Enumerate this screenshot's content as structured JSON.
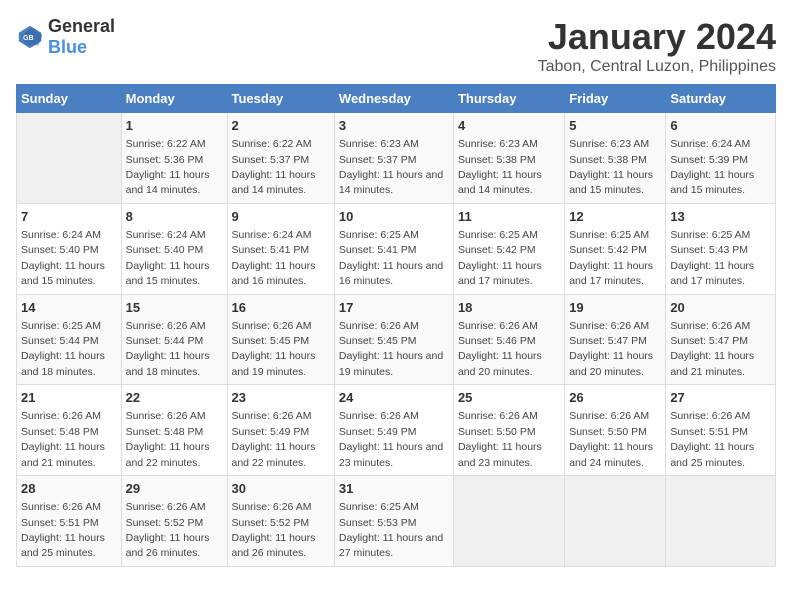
{
  "logo": {
    "text_general": "General",
    "text_blue": "Blue"
  },
  "title": "January 2024",
  "subtitle": "Tabon, Central Luzon, Philippines",
  "days_of_week": [
    "Sunday",
    "Monday",
    "Tuesday",
    "Wednesday",
    "Thursday",
    "Friday",
    "Saturday"
  ],
  "weeks": [
    [
      {
        "day": "",
        "sunrise": "",
        "sunset": "",
        "daylight": ""
      },
      {
        "day": "1",
        "sunrise": "Sunrise: 6:22 AM",
        "sunset": "Sunset: 5:36 PM",
        "daylight": "Daylight: 11 hours and 14 minutes."
      },
      {
        "day": "2",
        "sunrise": "Sunrise: 6:22 AM",
        "sunset": "Sunset: 5:37 PM",
        "daylight": "Daylight: 11 hours and 14 minutes."
      },
      {
        "day": "3",
        "sunrise": "Sunrise: 6:23 AM",
        "sunset": "Sunset: 5:37 PM",
        "daylight": "Daylight: 11 hours and 14 minutes."
      },
      {
        "day": "4",
        "sunrise": "Sunrise: 6:23 AM",
        "sunset": "Sunset: 5:38 PM",
        "daylight": "Daylight: 11 hours and 14 minutes."
      },
      {
        "day": "5",
        "sunrise": "Sunrise: 6:23 AM",
        "sunset": "Sunset: 5:38 PM",
        "daylight": "Daylight: 11 hours and 15 minutes."
      },
      {
        "day": "6",
        "sunrise": "Sunrise: 6:24 AM",
        "sunset": "Sunset: 5:39 PM",
        "daylight": "Daylight: 11 hours and 15 minutes."
      }
    ],
    [
      {
        "day": "7",
        "sunrise": "Sunrise: 6:24 AM",
        "sunset": "Sunset: 5:40 PM",
        "daylight": "Daylight: 11 hours and 15 minutes."
      },
      {
        "day": "8",
        "sunrise": "Sunrise: 6:24 AM",
        "sunset": "Sunset: 5:40 PM",
        "daylight": "Daylight: 11 hours and 15 minutes."
      },
      {
        "day": "9",
        "sunrise": "Sunrise: 6:24 AM",
        "sunset": "Sunset: 5:41 PM",
        "daylight": "Daylight: 11 hours and 16 minutes."
      },
      {
        "day": "10",
        "sunrise": "Sunrise: 6:25 AM",
        "sunset": "Sunset: 5:41 PM",
        "daylight": "Daylight: 11 hours and 16 minutes."
      },
      {
        "day": "11",
        "sunrise": "Sunrise: 6:25 AM",
        "sunset": "Sunset: 5:42 PM",
        "daylight": "Daylight: 11 hours and 17 minutes."
      },
      {
        "day": "12",
        "sunrise": "Sunrise: 6:25 AM",
        "sunset": "Sunset: 5:42 PM",
        "daylight": "Daylight: 11 hours and 17 minutes."
      },
      {
        "day": "13",
        "sunrise": "Sunrise: 6:25 AM",
        "sunset": "Sunset: 5:43 PM",
        "daylight": "Daylight: 11 hours and 17 minutes."
      }
    ],
    [
      {
        "day": "14",
        "sunrise": "Sunrise: 6:25 AM",
        "sunset": "Sunset: 5:44 PM",
        "daylight": "Daylight: 11 hours and 18 minutes."
      },
      {
        "day": "15",
        "sunrise": "Sunrise: 6:26 AM",
        "sunset": "Sunset: 5:44 PM",
        "daylight": "Daylight: 11 hours and 18 minutes."
      },
      {
        "day": "16",
        "sunrise": "Sunrise: 6:26 AM",
        "sunset": "Sunset: 5:45 PM",
        "daylight": "Daylight: 11 hours and 19 minutes."
      },
      {
        "day": "17",
        "sunrise": "Sunrise: 6:26 AM",
        "sunset": "Sunset: 5:45 PM",
        "daylight": "Daylight: 11 hours and 19 minutes."
      },
      {
        "day": "18",
        "sunrise": "Sunrise: 6:26 AM",
        "sunset": "Sunset: 5:46 PM",
        "daylight": "Daylight: 11 hours and 20 minutes."
      },
      {
        "day": "19",
        "sunrise": "Sunrise: 6:26 AM",
        "sunset": "Sunset: 5:47 PM",
        "daylight": "Daylight: 11 hours and 20 minutes."
      },
      {
        "day": "20",
        "sunrise": "Sunrise: 6:26 AM",
        "sunset": "Sunset: 5:47 PM",
        "daylight": "Daylight: 11 hours and 21 minutes."
      }
    ],
    [
      {
        "day": "21",
        "sunrise": "Sunrise: 6:26 AM",
        "sunset": "Sunset: 5:48 PM",
        "daylight": "Daylight: 11 hours and 21 minutes."
      },
      {
        "day": "22",
        "sunrise": "Sunrise: 6:26 AM",
        "sunset": "Sunset: 5:48 PM",
        "daylight": "Daylight: 11 hours and 22 minutes."
      },
      {
        "day": "23",
        "sunrise": "Sunrise: 6:26 AM",
        "sunset": "Sunset: 5:49 PM",
        "daylight": "Daylight: 11 hours and 22 minutes."
      },
      {
        "day": "24",
        "sunrise": "Sunrise: 6:26 AM",
        "sunset": "Sunset: 5:49 PM",
        "daylight": "Daylight: 11 hours and 23 minutes."
      },
      {
        "day": "25",
        "sunrise": "Sunrise: 6:26 AM",
        "sunset": "Sunset: 5:50 PM",
        "daylight": "Daylight: 11 hours and 23 minutes."
      },
      {
        "day": "26",
        "sunrise": "Sunrise: 6:26 AM",
        "sunset": "Sunset: 5:50 PM",
        "daylight": "Daylight: 11 hours and 24 minutes."
      },
      {
        "day": "27",
        "sunrise": "Sunrise: 6:26 AM",
        "sunset": "Sunset: 5:51 PM",
        "daylight": "Daylight: 11 hours and 25 minutes."
      }
    ],
    [
      {
        "day": "28",
        "sunrise": "Sunrise: 6:26 AM",
        "sunset": "Sunset: 5:51 PM",
        "daylight": "Daylight: 11 hours and 25 minutes."
      },
      {
        "day": "29",
        "sunrise": "Sunrise: 6:26 AM",
        "sunset": "Sunset: 5:52 PM",
        "daylight": "Daylight: 11 hours and 26 minutes."
      },
      {
        "day": "30",
        "sunrise": "Sunrise: 6:26 AM",
        "sunset": "Sunset: 5:52 PM",
        "daylight": "Daylight: 11 hours and 26 minutes."
      },
      {
        "day": "31",
        "sunrise": "Sunrise: 6:25 AM",
        "sunset": "Sunset: 5:53 PM",
        "daylight": "Daylight: 11 hours and 27 minutes."
      },
      {
        "day": "",
        "sunrise": "",
        "sunset": "",
        "daylight": ""
      },
      {
        "day": "",
        "sunrise": "",
        "sunset": "",
        "daylight": ""
      },
      {
        "day": "",
        "sunrise": "",
        "sunset": "",
        "daylight": ""
      }
    ]
  ]
}
